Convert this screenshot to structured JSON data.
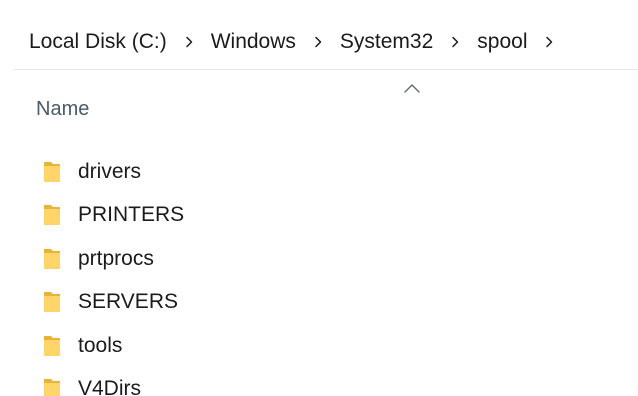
{
  "breadcrumb": {
    "items": [
      {
        "label": "Local Disk (C:)"
      },
      {
        "label": "Windows"
      },
      {
        "label": "System32"
      },
      {
        "label": "spool"
      }
    ],
    "separator_icon": "chevron-right-icon"
  },
  "columns": {
    "name_label": "Name",
    "sort_icon": "chevron-up-icon",
    "sort_direction": "ascending"
  },
  "files": [
    {
      "name": "drivers",
      "icon": "folder-icon"
    },
    {
      "name": "PRINTERS",
      "icon": "folder-icon"
    },
    {
      "name": "prtprocs",
      "icon": "folder-icon"
    },
    {
      "name": "SERVERS",
      "icon": "folder-icon"
    },
    {
      "name": "tools",
      "icon": "folder-icon"
    },
    {
      "name": "V4Dirs",
      "icon": "folder-icon"
    }
  ],
  "colors": {
    "folder_back": "#e8b33a",
    "folder_front": "#ffd56a",
    "separator": "#1b1b1b",
    "header_text": "#4a5a6a"
  }
}
